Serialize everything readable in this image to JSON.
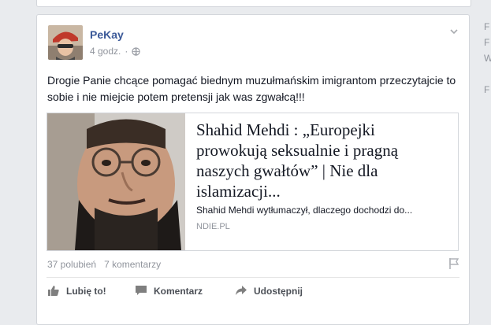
{
  "post": {
    "author": "PeKay",
    "time": "4 godz.",
    "separator": "·",
    "text": "Drogie Panie chcące pomagać biednym muzułmańskim imigrantom przeczytajcie to sobie i nie miejcie potem pretensji jak was zgwałcą!!!",
    "link": {
      "title": "Shahid Mehdi : „Europejki prowokują seksualnie i pragną naszych gwałtów” | Nie dla islamizacji...",
      "description": "Shahid Mehdi wytłumaczył, dlaczego dochodzi do...",
      "domain": "NDIE.PL"
    },
    "counts": {
      "likes": "37 polubień",
      "comments": "7 komentarzy"
    },
    "actions": {
      "like": "Lubię to!",
      "comment": "Komentarz",
      "share": "Udostępnij"
    }
  },
  "sidebar": {
    "letters": [
      "F",
      "F",
      "W",
      "",
      "F"
    ]
  },
  "colors": {
    "link_blue": "#3b5998",
    "muted": "#90949c",
    "text": "#141823"
  },
  "icons": [
    "globe-icon",
    "chevron-down-icon",
    "flag-icon",
    "thumbs-up-icon",
    "comment-icon",
    "share-icon"
  ]
}
